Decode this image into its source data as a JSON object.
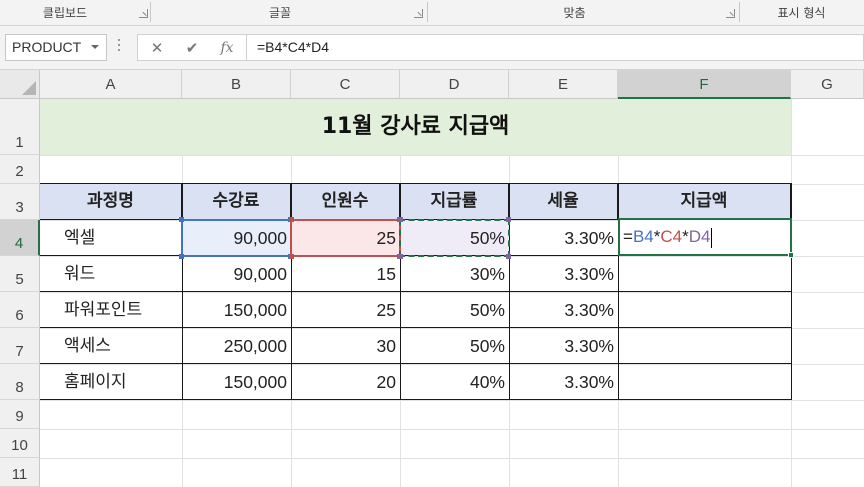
{
  "ribbon": {
    "groups": [
      "클립보드",
      "글꼴",
      "맞춤",
      "표시 형식"
    ]
  },
  "formula_bar": {
    "name_box": "PRODUCT",
    "cancel_glyph": "✕",
    "enter_glyph": "✔",
    "function_glyph": "fx",
    "formula": "=B4*C4*D4"
  },
  "columns": [
    "A",
    "B",
    "C",
    "D",
    "E",
    "F",
    "G"
  ],
  "rows": [
    "1",
    "2",
    "3",
    "4",
    "5",
    "6",
    "7",
    "8",
    "9",
    "10",
    "11"
  ],
  "sheet": {
    "title": "11월 강사료 지급액",
    "headers": [
      "과정명",
      "수강료",
      "인원수",
      "지급률",
      "세율",
      "지급액"
    ],
    "data": [
      {
        "course": "엑셀",
        "fee": "90,000",
        "count": "25",
        "rate": "50%",
        "tax": "3.30%"
      },
      {
        "course": "워드",
        "fee": "90,000",
        "count": "15",
        "rate": "30%",
        "tax": "3.30%"
      },
      {
        "course": "파워포인트",
        "fee": "150,000",
        "count": "25",
        "rate": "50%",
        "tax": "3.30%"
      },
      {
        "course": "액세스",
        "fee": "250,000",
        "count": "30",
        "rate": "50%",
        "tax": "3.30%"
      },
      {
        "course": "홈페이지",
        "fee": "150,000",
        "count": "20",
        "rate": "40%",
        "tax": "3.30%"
      }
    ],
    "editing": {
      "cell": "F4",
      "eq": "=",
      "ref1": "B4",
      "op1": "*",
      "ref2": "C4",
      "op2": "*",
      "ref3": "D4"
    }
  },
  "colors": {
    "ref_b": "#4472c4",
    "ref_c": "#c0504d",
    "ref_d": "#8064a2",
    "excel_green": "#217346",
    "title_fill": "#e2efda",
    "header_fill": "#d9e1f2"
  }
}
